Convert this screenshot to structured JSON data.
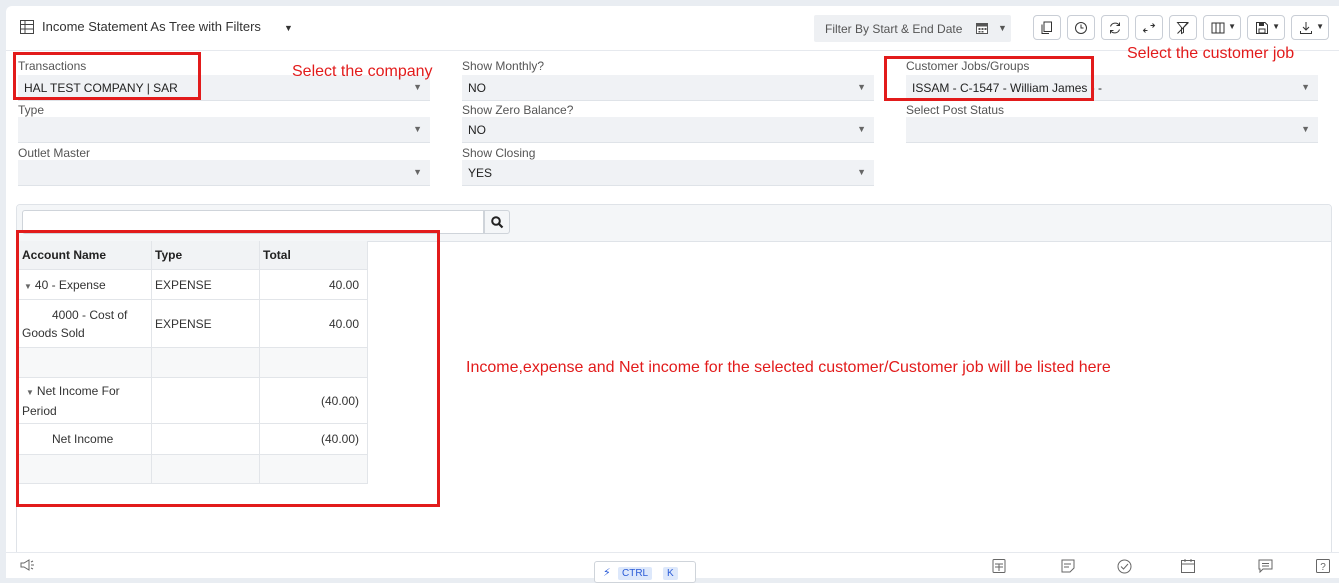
{
  "header": {
    "title": "Income Statement As Tree with Filters",
    "filter_date_label": "Filter By Start & End Date"
  },
  "toolbar_icons": [
    "copy-icon",
    "clock-icon",
    "refresh-icon",
    "expand-icon",
    "clear-filter-icon",
    "columns-icon",
    "save-icon",
    "download-icon"
  ],
  "filters": {
    "transactions": {
      "label": "Transactions",
      "value": "HAL TEST COMPANY | SAR"
    },
    "type": {
      "label": "Type",
      "value": ""
    },
    "outlet_master": {
      "label": "Outlet Master",
      "value": ""
    },
    "show_monthly": {
      "label": "Show Monthly?",
      "value": "NO"
    },
    "show_zero_balance": {
      "label": "Show Zero Balance?",
      "value": "NO"
    },
    "show_closing": {
      "label": "Show Closing",
      "value": "YES"
    },
    "customer_jobs": {
      "label": "Customer Jobs/Groups",
      "value": "ISSAM - C-1547 - William James -  -"
    },
    "select_post_status": {
      "label": "Select Post Status",
      "value": ""
    }
  },
  "grid": {
    "columns": {
      "account_name": "Account Name",
      "type": "Type",
      "total": "Total"
    },
    "rows": [
      {
        "account": "40 - Expense",
        "type": "EXPENSE",
        "total": "40.00"
      },
      {
        "account": "4000 - Cost of Goods Sold",
        "type": "EXPENSE",
        "total": "40.00"
      },
      {
        "account": "",
        "type": "",
        "total": ""
      },
      {
        "account": "Net Income For Period",
        "type": "",
        "total": "(40.00)"
      },
      {
        "account": "Net Income",
        "type": "",
        "total": "(40.00)"
      },
      {
        "account": "",
        "type": "",
        "total": ""
      }
    ]
  },
  "status_bar": {
    "shortcut_ctrl": "CTRL",
    "shortcut_key": "K"
  },
  "annotations": {
    "select_company": "Select the company",
    "select_customer_job": "Select the customer job",
    "listing_note": "Income,expense and Net income for the selected customer/Customer job will be listed here"
  },
  "colors": {
    "annotation": "#e21b1b",
    "accent": "#2a5bd7"
  }
}
